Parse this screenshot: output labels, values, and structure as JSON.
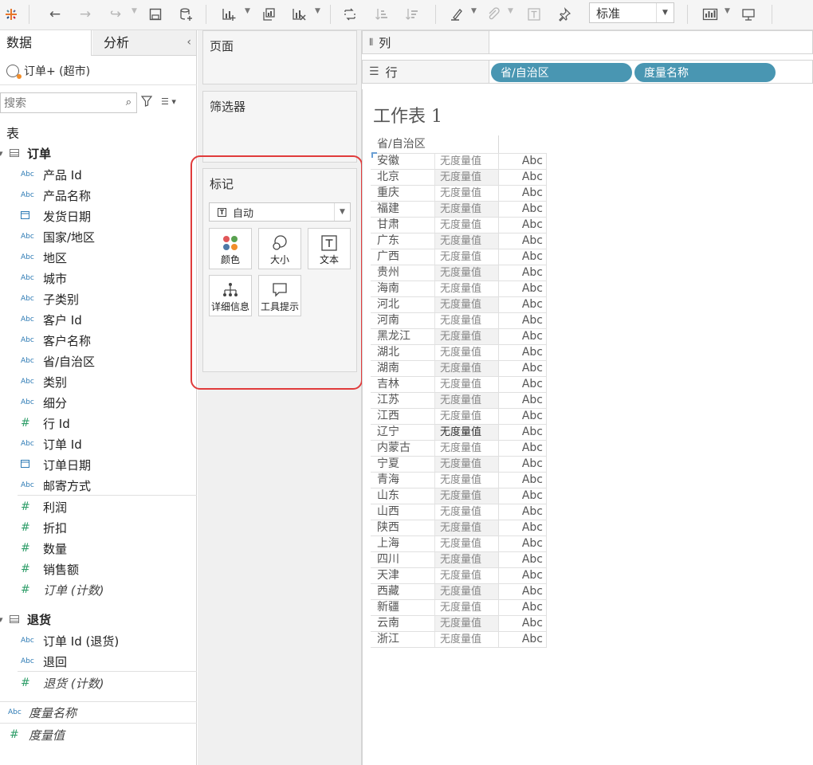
{
  "toolbar": {
    "fit_value": "标准",
    "icons": [
      "tableau-logo-icon",
      "undo-icon",
      "redo-icon",
      "replay-icon",
      "save-icon",
      "new-datasource-icon",
      "new-worksheet-icon",
      "duplicate-icon",
      "clear-sheet-icon",
      "swap-icon",
      "sort-asc-icon",
      "sort-desc-icon",
      "highlight-icon",
      "group-icon",
      "label-icon",
      "pin-icon",
      "show-me-icon",
      "presentation-icon"
    ]
  },
  "left": {
    "tab_data": "数据",
    "tab_analysis": "分析",
    "datasource": "订单+ (超市)",
    "search_placeholder": "搜索",
    "section_table": "表",
    "table_orders": "订单",
    "orders_dims": [
      {
        "type": "Abc",
        "name": "产品 Id"
      },
      {
        "type": "Abc",
        "name": "产品名称"
      },
      {
        "type": "date",
        "name": "发货日期"
      },
      {
        "type": "Abc",
        "name": "国家/地区"
      },
      {
        "type": "Abc",
        "name": "地区"
      },
      {
        "type": "Abc",
        "name": "城市"
      },
      {
        "type": "Abc",
        "name": "子类别"
      },
      {
        "type": "Abc",
        "name": "客户 Id"
      },
      {
        "type": "Abc",
        "name": "客户名称"
      },
      {
        "type": "Abc",
        "name": "省/自治区"
      },
      {
        "type": "Abc",
        "name": "类别"
      },
      {
        "type": "Abc",
        "name": "细分"
      },
      {
        "type": "#",
        "name": "行 Id"
      },
      {
        "type": "Abc",
        "name": "订单 Id"
      },
      {
        "type": "date",
        "name": "订单日期"
      },
      {
        "type": "Abc",
        "name": "邮寄方式"
      }
    ],
    "orders_measures": [
      {
        "type": "#",
        "name": "利润"
      },
      {
        "type": "#",
        "name": "折扣"
      },
      {
        "type": "#",
        "name": "数量"
      },
      {
        "type": "#",
        "name": "销售额"
      },
      {
        "type": "#",
        "name": "订单 (计数)"
      }
    ],
    "table_returns": "退货",
    "returns_dims": [
      {
        "type": "Abc",
        "name": "订单 Id (退货)"
      },
      {
        "type": "Abc",
        "name": "退回"
      }
    ],
    "returns_measures": [
      {
        "type": "#",
        "name": "退货 (计数)"
      }
    ],
    "measure_names": {
      "type": "Abc",
      "name": "度量名称"
    },
    "measure_values": {
      "type": "#",
      "name": "度量值"
    }
  },
  "cards": {
    "pages": "页面",
    "filters": "筛选器",
    "marks": "标记",
    "mark_type": "自动",
    "buttons": {
      "color": "颜色",
      "size": "大小",
      "text": "文本",
      "detail": "详细信息",
      "tooltip": "工具提示"
    }
  },
  "shelves": {
    "columns": "列",
    "rows": "行",
    "pill1": "省/自治区",
    "pill2": "度量名称"
  },
  "sheet": {
    "title": "工作表 1",
    "header": "省/自治区",
    "no_measure": "无度量值",
    "abc": "Abc",
    "provinces": [
      "安徽",
      "北京",
      "重庆",
      "福建",
      "甘肃",
      "广东",
      "广西",
      "贵州",
      "海南",
      "河北",
      "河南",
      "黑龙江",
      "湖北",
      "湖南",
      "吉林",
      "江苏",
      "江西",
      "辽宁",
      "内蒙古",
      "宁夏",
      "青海",
      "山东",
      "山西",
      "陕西",
      "上海",
      "四川",
      "天津",
      "西藏",
      "新疆",
      "云南",
      "浙江"
    ]
  },
  "colors": {
    "pill": "#4996b2",
    "highlight": "#e03b3b",
    "dimension": "#2e7bb5",
    "measure": "#2f9e69"
  }
}
